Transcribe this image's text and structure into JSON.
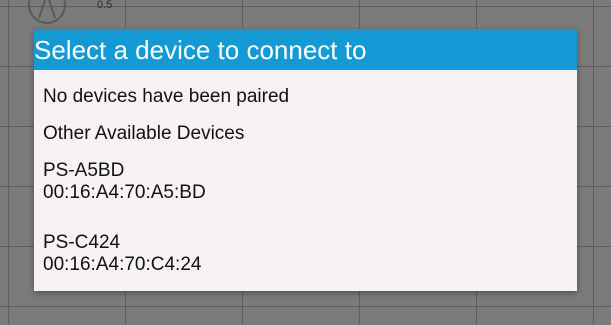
{
  "background": {
    "axis_label": "0.5",
    "logo_icon": "instrument-logo-icon"
  },
  "dialog": {
    "title": "Select a device to connect to",
    "paired_message": "No devices have been paired",
    "other_section_label": "Other Available Devices",
    "devices": [
      {
        "name": "PS-A5BD",
        "address": "00:16:A4:70:A5:BD"
      },
      {
        "name": "PS-C424",
        "address": "00:16:A4:70:C4:24"
      }
    ],
    "header_color": "#139ad4",
    "background_color": "#f6f2f6"
  }
}
